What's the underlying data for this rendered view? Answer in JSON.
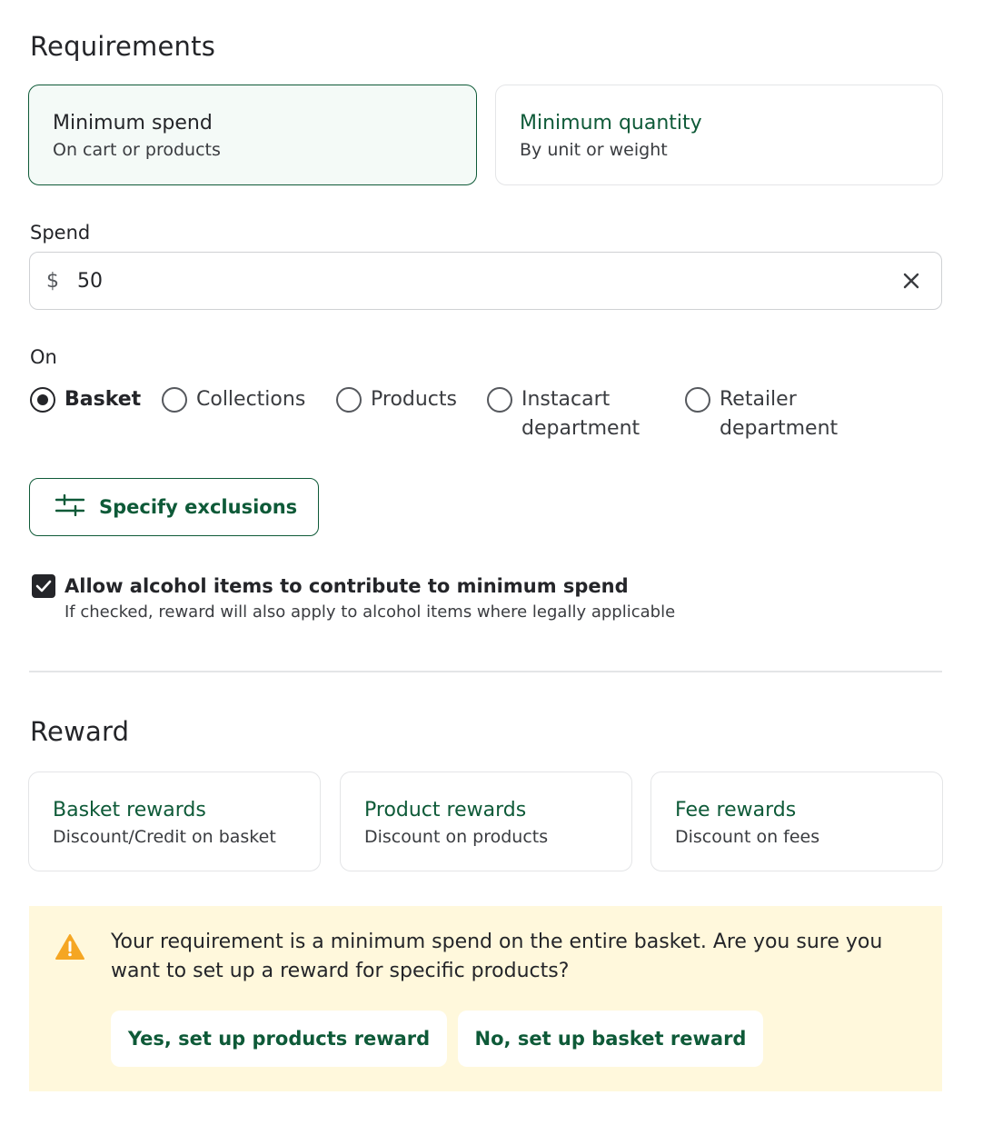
{
  "requirements": {
    "title": "Requirements",
    "cards": [
      {
        "title": "Minimum spend",
        "subtitle": "On cart or products"
      },
      {
        "title": "Minimum quantity",
        "subtitle": "By unit or weight"
      }
    ]
  },
  "spend": {
    "label": "Spend",
    "prefix": "$",
    "value": "50"
  },
  "on": {
    "label": "On",
    "options": [
      {
        "label": "Basket",
        "checked": true
      },
      {
        "label": "Collections",
        "checked": false
      },
      {
        "label": "Products",
        "checked": false
      },
      {
        "label": "Instacart department",
        "checked": false
      },
      {
        "label": "Retailer department",
        "checked": false
      }
    ]
  },
  "exclusions_button": {
    "label": "Specify exclusions",
    "icon": "sliders-icon"
  },
  "alcohol": {
    "checked": true,
    "label": "Allow alcohol items to contribute to minimum spend",
    "help": "If checked, reward will also apply to alcohol items where legally applicable"
  },
  "reward": {
    "title": "Reward",
    "cards": [
      {
        "title": "Basket rewards",
        "subtitle": "Discount/Credit on basket"
      },
      {
        "title": "Product rewards",
        "subtitle": "Discount on products"
      },
      {
        "title": "Fee rewards",
        "subtitle": "Discount on fees"
      }
    ]
  },
  "warning": {
    "icon": "warning-icon",
    "message": "Your requirement is a minimum spend on the entire basket. Are you sure you want to set up a reward for specific products?",
    "yes_label": "Yes, set up products reward",
    "no_label": "No, set up basket reward"
  },
  "colors": {
    "brand_green": "#0e5a38",
    "selected_bg": "#f4faf7",
    "warning_bg": "#fff8dc",
    "warning_icon": "#f5a623"
  }
}
